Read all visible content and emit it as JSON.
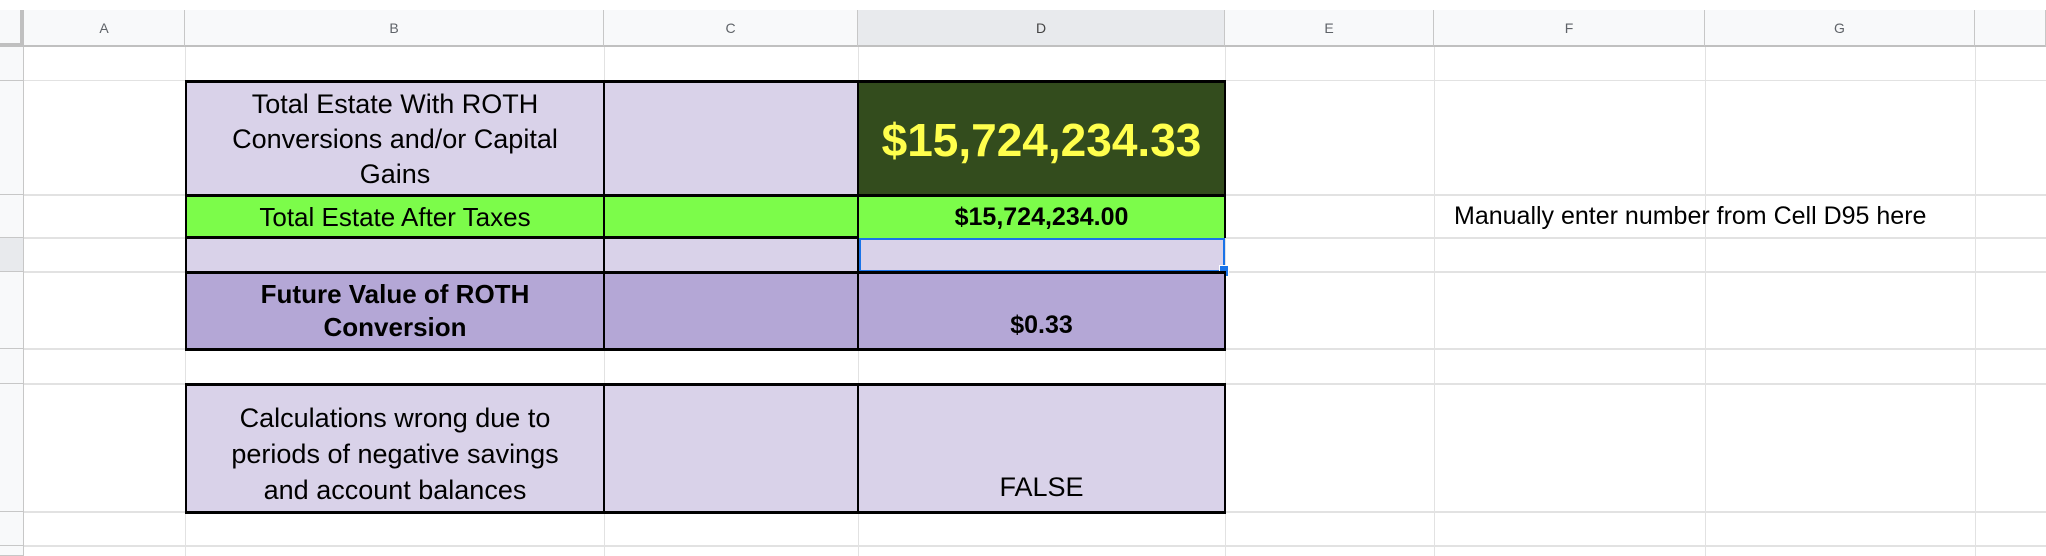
{
  "columns": [
    "A",
    "B",
    "C",
    "D",
    "E",
    "F",
    "G"
  ],
  "selected_column": "D",
  "cells": {
    "B2": "Total Estate With ROTH Conversions and/or Capital Gains",
    "D2": "$15,724,234.33",
    "B3": "Total Estate After Taxes",
    "D3": "$15,724,234.00",
    "F3": "Manually enter number from Cell D95 here",
    "B5": "Future Value of ROTH Conversion",
    "D5": "$0.33",
    "B7": "Calculations wrong due to periods of negative savings and account balances",
    "D7": "FALSE"
  },
  "colors": {
    "lavender": "#d9d2e9",
    "purple": "#b4a7d6",
    "green": "#7cfc4a",
    "dark_green": "#334c1d",
    "yellow_text": "#ffff4d",
    "selection": "#1a73e8"
  }
}
